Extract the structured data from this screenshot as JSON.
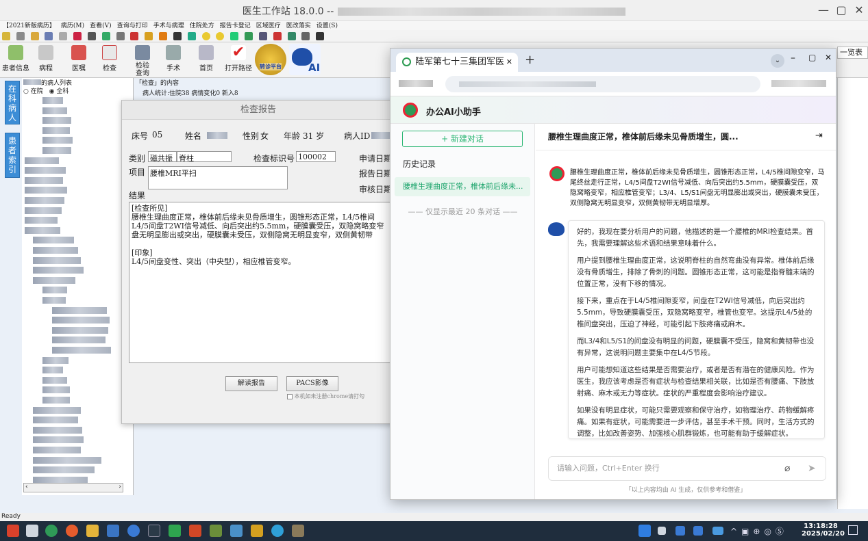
{
  "window": {
    "title": "医生工作站 18.0.0 --",
    "min": "—",
    "max": "▢",
    "close": "✕"
  },
  "menu": [
    "【2021新版病历】",
    "病历(M)",
    "查看(V)",
    "查询与打印",
    "手术与病理",
    "住院处方",
    "报告卡登记",
    "区域医疗",
    "医改落实",
    "设置(S)"
  ],
  "toolbar": {
    "buttons": [
      "患者信息",
      "病程",
      "医嘱",
      "检查",
      "检验查询",
      "手术",
      "首页",
      "打开路径"
    ],
    "badge1": "转诊平台",
    "badge2": "AI"
  },
  "left_panel": {
    "tab_in_hospital": "在科病人",
    "tab_index": "患者索引",
    "list_title": "的病人列表",
    "radio_in": "在院",
    "radio_all": "全科"
  },
  "content_header": {
    "title": "「检查」的内容",
    "stats": "病人统计:住院38 病情变化0 新入8"
  },
  "report": {
    "title": "检查报告",
    "bed_label": "床号",
    "bed_value": "05",
    "name_label": "姓名",
    "gender_label": "性别",
    "gender_value": "女",
    "age_label": "年龄",
    "age_value": "31 岁",
    "pid_label": "病人ID",
    "type_label": "类别",
    "type_value1": "磁共振",
    "type_value2": "脊柱",
    "mark_label": "检查标识号",
    "mark_value": "100002",
    "apply_date_label": "申请日期",
    "report_date_label": "报告日期",
    "audit_date_label": "审核日期",
    "item_label": "项目",
    "item_value": "腰椎MRI平扫",
    "result_label": "结果",
    "result_text": "[检查所见]\n腰椎生理曲度正常，椎体前后缘未见骨质增生，圆锥形态正常，L4/5椎间\nL4/5间盘T2WI信号减低、向后突出约5.5mm，硬膜囊受压，双隐窝略变窄\n盘无明显膨出或突出，硬膜囊未受压，双侧隐窝无明显变窄，双侧黄韧带\n\n[印象]\nL4/5间盘变性、突出（中央型），相应椎管变窄。",
    "read_button": "解读报告",
    "pacs_button": "PACS影像",
    "chrome_note": "本机如未注册chrome请打勾"
  },
  "browser": {
    "tab_title": "陆军第七十三集团军医",
    "tab_close": "✕",
    "new_tab": "+",
    "assistant_title": "办公AI小助手",
    "new_chat": "+ 新建对话",
    "history_label": "历史记录",
    "history_item": "腰椎生理曲度正常，椎体前后缘未...",
    "history_note": "仅显示最近 20 条对话",
    "conversation_title": "腰椎生理曲度正常，椎体前后缘未见骨质增生，圆...",
    "user_message": "腰椎生理曲度正常，椎体前后缘未见骨质增生，圆锥形态正常，L4/5椎间隙变窄，马尾终丝走行正常，L4/5间盘T2WI信号减低、向后突出约5.5mm，硬膜囊受压，双隐窝略变窄，相应椎管变窄；L3/4、L5/S1间盘无明显膨出或突出，硬膜囊未受压，双侧隐窝无明显变窄，双侧黄韧带无明显增厚。",
    "answer_paragraphs": [
      "好的，我现在要分析用户的问题，他描述的是一个腰椎的MRI检查结果。首先，我需要理解这些术语和结果意味着什么。",
      "用户提到腰椎生理曲度正常，这说明脊柱的自然弯曲没有异常。椎体前后缘没有骨质增生，排除了骨刺的问题。圆锥形态正常，这可能是指脊髓末端的位置正常，没有下移的情况。",
      "接下来，重点在于L4/5椎间隙变窄，间盘在T2WI信号减低，向后突出约5.5mm，导致硬膜囊受压，双隐窝略变窄，椎管也变窄。这提示L4/5处的椎间盘突出，压迫了神经，可能引起下肢疼痛或麻木。",
      "而L3/4和L5/S1的间盘没有明显的问题，硬膜囊不受压，隐窝和黄韧带也没有异常，这说明问题主要集中在L4/5节段。",
      "用户可能想知道这些结果是否需要治疗，或者是否有潜在的健康风险。作为医生，我应该考虑是否有症状与检查结果相关联，比如是否有腰痛、下肢放射痛、麻木或无力等症状。症状的严重程度会影响治疗建议。",
      "如果没有明显症状，可能只需要观察和保守治疗，如物理治疗、药物缓解疼痛。如果有症状，可能需要进一步评估，甚至手术干预。同时，生活方式的调整，比如改善姿势、加强核心肌群锻炼，也可能有助于缓解症状。"
    ],
    "input_placeholder": "请输入问题，Ctrl+Enter 换行",
    "disclaimer": "「以上内容均由 AI 生成，仅供参考和借鉴」"
  },
  "partial_right_label": "一览表",
  "status": "Ready",
  "taskbar": {
    "time": "13:18:28",
    "date": "2025/02/20"
  }
}
